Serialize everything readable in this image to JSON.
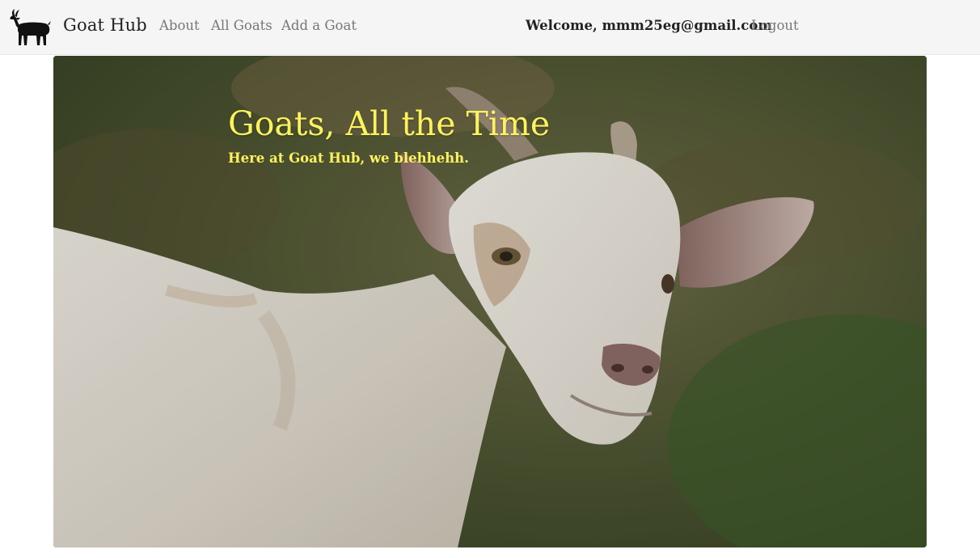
{
  "navbar": {
    "brand_icon": "goat-silhouette-icon",
    "brand_name": "Goat Hub",
    "links": [
      "About",
      "All Goats",
      "Add a Goat"
    ],
    "welcome_text": "Welcome, mmm25eg@gmail.com",
    "logout_label": "Logout"
  },
  "hero": {
    "title": "Goats, All the Time",
    "subtitle": "Here at Goat Hub, we blehhehh.",
    "text_color": "#fff35c",
    "image_subject": "white-goat-photo"
  }
}
